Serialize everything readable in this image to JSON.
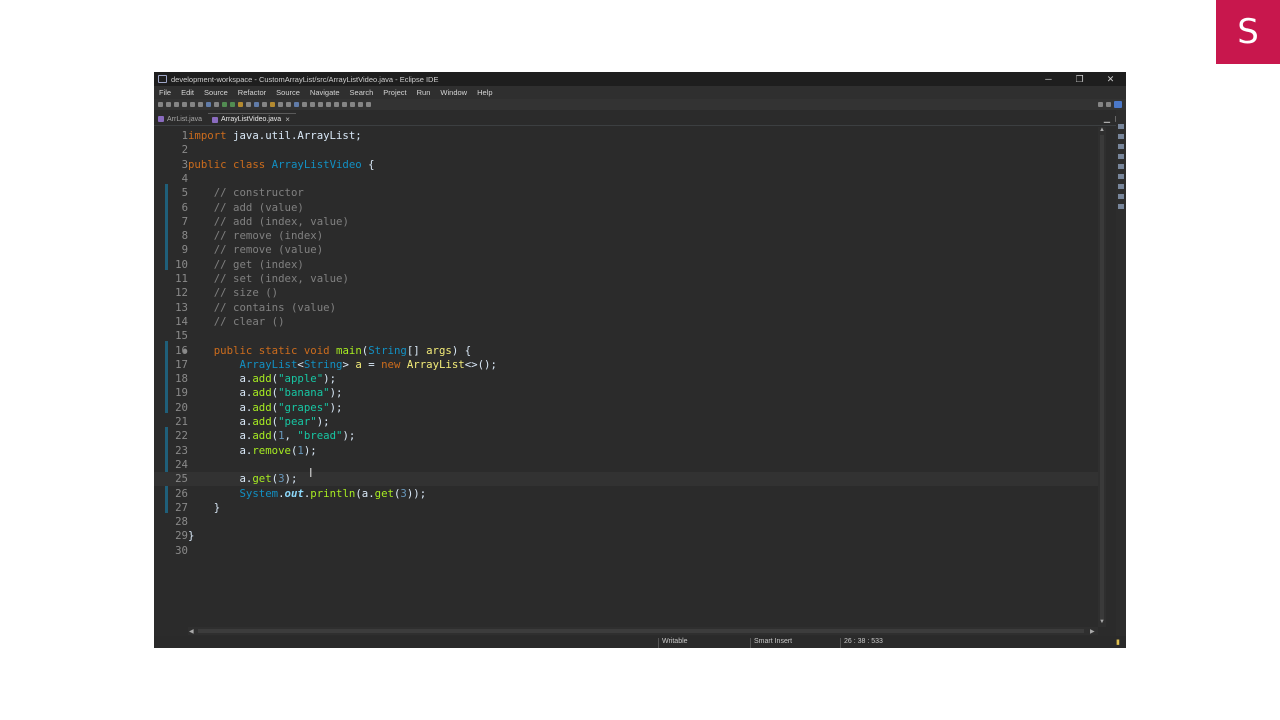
{
  "brand": {
    "letter": "S",
    "color": "#c8174d"
  },
  "window": {
    "title": "development-workspace - CustomArrayList/src/ArrayListVideo.java - Eclipse IDE",
    "controls": {
      "minimize": "─",
      "restore": "❐",
      "close": "✕"
    }
  },
  "menu": [
    "File",
    "Edit",
    "Source",
    "Refactor",
    "Source",
    "Navigate",
    "Search",
    "Project",
    "Run",
    "Window",
    "Help"
  ],
  "tabs": [
    {
      "label": "ArrList.java",
      "active": false
    },
    {
      "label": "ArrayListVideo.java",
      "active": true,
      "close": "×"
    }
  ],
  "editor": {
    "current_line": 25,
    "lines": [
      {
        "n": "1",
        "segs": [
          [
            "kw",
            "import"
          ],
          [
            "pl",
            " java.util.ArrayList;"
          ]
        ]
      },
      {
        "n": "2",
        "segs": []
      },
      {
        "n": "3",
        "segs": [
          [
            "kw",
            "public class"
          ],
          [
            "pl",
            " "
          ],
          [
            "ty",
            "ArrayListVideo"
          ],
          [
            "pl",
            " {"
          ]
        ]
      },
      {
        "n": "4",
        "segs": []
      },
      {
        "n": "5",
        "segs": [
          [
            "pl",
            "    "
          ],
          [
            "cm",
            "// constructor"
          ]
        ]
      },
      {
        "n": "6",
        "segs": [
          [
            "pl",
            "    "
          ],
          [
            "cm",
            "// add (value)"
          ]
        ]
      },
      {
        "n": "7",
        "segs": [
          [
            "pl",
            "    "
          ],
          [
            "cm",
            "// add (index, value)"
          ]
        ]
      },
      {
        "n": "8",
        "segs": [
          [
            "pl",
            "    "
          ],
          [
            "cm",
            "// remove (index)"
          ]
        ]
      },
      {
        "n": "9",
        "segs": [
          [
            "pl",
            "    "
          ],
          [
            "cm",
            "// remove (value)"
          ]
        ]
      },
      {
        "n": "10",
        "segs": [
          [
            "pl",
            "    "
          ],
          [
            "cm",
            "// get (index)"
          ]
        ]
      },
      {
        "n": "11",
        "segs": [
          [
            "pl",
            "    "
          ],
          [
            "cm",
            "// set (index, value)"
          ]
        ]
      },
      {
        "n": "12",
        "segs": [
          [
            "pl",
            "    "
          ],
          [
            "cm",
            "// size ()"
          ]
        ]
      },
      {
        "n": "13",
        "segs": [
          [
            "pl",
            "    "
          ],
          [
            "cm",
            "// contains (value)"
          ]
        ]
      },
      {
        "n": "14",
        "segs": [
          [
            "pl",
            "    "
          ],
          [
            "cm",
            "// clear ()"
          ]
        ]
      },
      {
        "n": "15",
        "segs": []
      },
      {
        "n": "16",
        "fold": "●",
        "segs": [
          [
            "pl",
            "    "
          ],
          [
            "kw",
            "public static void"
          ],
          [
            "pl",
            " "
          ],
          [
            "mt",
            "main"
          ],
          [
            "pl",
            "("
          ],
          [
            "ty",
            "String"
          ],
          [
            "pl",
            "[] "
          ],
          [
            "var",
            "args"
          ],
          [
            "pl",
            ") {"
          ]
        ]
      },
      {
        "n": "17",
        "segs": [
          [
            "pl",
            "        "
          ],
          [
            "ty",
            "ArrayList"
          ],
          [
            "pl",
            "<"
          ],
          [
            "ty",
            "String"
          ],
          [
            "pl",
            "> "
          ],
          [
            "var",
            "a"
          ],
          [
            "pl",
            " = "
          ],
          [
            "kw",
            "new"
          ],
          [
            "pl",
            " "
          ],
          [
            "var",
            "ArrayList"
          ],
          [
            "pl",
            "<>();"
          ]
        ]
      },
      {
        "n": "18",
        "segs": [
          [
            "pl",
            "        a."
          ],
          [
            "mt",
            "add"
          ],
          [
            "pl",
            "("
          ],
          [
            "st",
            "\"apple\""
          ],
          [
            "pl",
            ");"
          ]
        ]
      },
      {
        "n": "19",
        "segs": [
          [
            "pl",
            "        a."
          ],
          [
            "mt",
            "add"
          ],
          [
            "pl",
            "("
          ],
          [
            "st",
            "\"banana\""
          ],
          [
            "pl",
            ");"
          ]
        ]
      },
      {
        "n": "20",
        "segs": [
          [
            "pl",
            "        a."
          ],
          [
            "mt",
            "add"
          ],
          [
            "pl",
            "("
          ],
          [
            "st",
            "\"grapes\""
          ],
          [
            "pl",
            ");"
          ]
        ]
      },
      {
        "n": "21",
        "segs": [
          [
            "pl",
            "        a."
          ],
          [
            "mt",
            "add"
          ],
          [
            "pl",
            "("
          ],
          [
            "st",
            "\"pear\""
          ],
          [
            "pl",
            ");"
          ]
        ]
      },
      {
        "n": "22",
        "segs": [
          [
            "pl",
            "        a."
          ],
          [
            "mt",
            "add"
          ],
          [
            "pl",
            "("
          ],
          [
            "nm",
            "1"
          ],
          [
            "pl",
            ", "
          ],
          [
            "st",
            "\"bread\""
          ],
          [
            "pl",
            ");"
          ]
        ]
      },
      {
        "n": "23",
        "segs": [
          [
            "pl",
            "        a."
          ],
          [
            "mt",
            "remove"
          ],
          [
            "pl",
            "("
          ],
          [
            "nm",
            "1"
          ],
          [
            "pl",
            ");"
          ]
        ]
      },
      {
        "n": "24",
        "segs": []
      },
      {
        "n": "25",
        "segs": [
          [
            "pl",
            "        a."
          ],
          [
            "mt",
            "get"
          ],
          [
            "pl",
            "("
          ],
          [
            "nm",
            "3"
          ],
          [
            "pl",
            ");"
          ]
        ]
      },
      {
        "n": "26",
        "segs": [
          [
            "pl",
            "        "
          ],
          [
            "ty",
            "System"
          ],
          [
            "pl",
            "."
          ],
          [
            "fs",
            "out"
          ],
          [
            "pl",
            "."
          ],
          [
            "mt",
            "println"
          ],
          [
            "pl",
            "(a."
          ],
          [
            "mt",
            "get"
          ],
          [
            "pl",
            "("
          ],
          [
            "nm",
            "3"
          ],
          [
            "pl",
            "));"
          ]
        ]
      },
      {
        "n": "27",
        "segs": [
          [
            "pl",
            "    }"
          ]
        ]
      },
      {
        "n": "28",
        "segs": []
      },
      {
        "n": "29",
        "segs": [
          [
            "pl",
            "}"
          ]
        ]
      },
      {
        "n": "30",
        "segs": []
      }
    ]
  },
  "status": {
    "mode": "Writable",
    "insert": "Smart Insert",
    "position": "26 : 38 : 533"
  },
  "icons": {
    "cursor": "text-cursor-icon",
    "ibeam_glyph": "I"
  }
}
